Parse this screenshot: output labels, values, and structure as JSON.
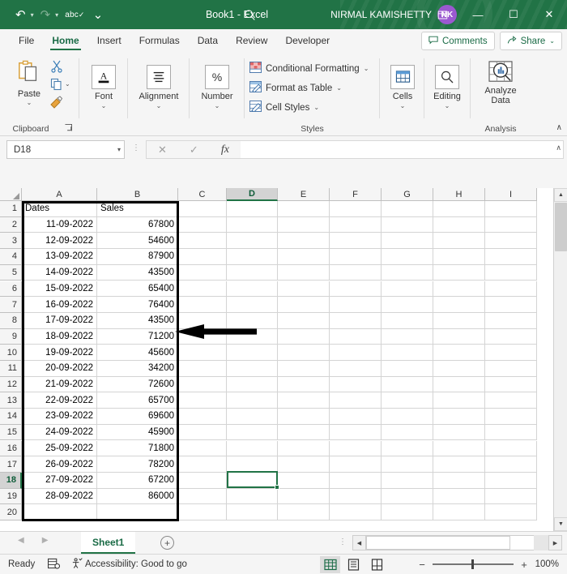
{
  "titlebar": {
    "document_title": "Book1  -  Excel",
    "account_name": "NIRMAL KAMISHETTY",
    "avatar_initials": "NK",
    "qat": [
      {
        "name": "undo",
        "glyph": "↶"
      },
      {
        "name": "redo",
        "glyph": "↷"
      },
      {
        "name": "spelling",
        "glyph": "abc"
      },
      {
        "name": "customize-qat",
        "glyph": "⌄"
      }
    ],
    "search_glyph": "⚲",
    "window_controls": {
      "ribbon_display": "⤒",
      "minimize": "—",
      "maximize": "☐",
      "close": "✕"
    }
  },
  "tabs": [
    {
      "label": "File",
      "active": false
    },
    {
      "label": "Home",
      "active": true
    },
    {
      "label": "Insert",
      "active": false
    },
    {
      "label": "Formulas",
      "active": false
    },
    {
      "label": "Data",
      "active": false
    },
    {
      "label": "Review",
      "active": false
    },
    {
      "label": "Developer",
      "active": false
    }
  ],
  "tabrow_right": {
    "comments_label": "Comments",
    "comments_icon": "▢",
    "share_label": "Share",
    "share_icon": "↗",
    "share_caret": "⌄"
  },
  "ribbon": {
    "clipboard": {
      "group_label": "Clipboard",
      "paste_label": "Paste",
      "paste_caret": "⌄",
      "cut_icon": "✂",
      "copy_icon": "❐",
      "copy_caret": "⌄",
      "format_painter_icon": "✎",
      "dialog_launcher": "↘"
    },
    "font": {
      "label": "Font",
      "icon": "A",
      "caret": "⌄"
    },
    "alignment": {
      "label": "Alignment",
      "icon": "≡",
      "caret": "⌄"
    },
    "number": {
      "label": "Number",
      "icon": "%",
      "caret": "⌄"
    },
    "styles": {
      "group_label": "Styles",
      "items": [
        {
          "label": "Conditional Formatting",
          "caret": "⌄"
        },
        {
          "label": "Format as Table",
          "caret": "⌄"
        },
        {
          "label": "Cell Styles",
          "caret": "⌄"
        }
      ]
    },
    "cells": {
      "label": "Cells",
      "icon": "⊞",
      "caret": "⌄"
    },
    "editing": {
      "label": "Editing",
      "icon": "⚲",
      "caret": "⌄"
    },
    "analysis": {
      "group_label": "Analysis",
      "analyze_label_line1": "Analyze",
      "analyze_label_line2": "Data"
    },
    "collapse_icon": "∧"
  },
  "formula_bar": {
    "name_box_value": "D18",
    "name_box_caret": "▾",
    "dots": "⋮",
    "cancel_icon": "✕",
    "enter_icon": "✓",
    "function_icon": "fx",
    "formula_value": "",
    "expand_icon": "∧"
  },
  "grid": {
    "column_headers": [
      "A",
      "B",
      "C",
      "D",
      "E",
      "F",
      "G",
      "H",
      "I"
    ],
    "selected_column": "D",
    "row_headers": [
      "1",
      "2",
      "3",
      "4",
      "5",
      "6",
      "7",
      "8",
      "9",
      "10",
      "11",
      "12",
      "13",
      "14",
      "15",
      "16",
      "17",
      "18",
      "19",
      "20"
    ],
    "selected_row": "18",
    "headers": [
      "Dates",
      "Sales"
    ],
    "rows": [
      {
        "date": "11-09-2022",
        "sales": "67800"
      },
      {
        "date": "12-09-2022",
        "sales": "54600"
      },
      {
        "date": "13-09-2022",
        "sales": "87900"
      },
      {
        "date": "14-09-2022",
        "sales": "43500"
      },
      {
        "date": "15-09-2022",
        "sales": "65400"
      },
      {
        "date": "16-09-2022",
        "sales": "76400"
      },
      {
        "date": "17-09-2022",
        "sales": "43500"
      },
      {
        "date": "18-09-2022",
        "sales": "71200"
      },
      {
        "date": "19-09-2022",
        "sales": "45600"
      },
      {
        "date": "20-09-2022",
        "sales": "34200"
      },
      {
        "date": "21-09-2022",
        "sales": "72600"
      },
      {
        "date": "22-09-2022",
        "sales": "65700"
      },
      {
        "date": "23-09-2022",
        "sales": "69600"
      },
      {
        "date": "24-09-2022",
        "sales": "45900"
      },
      {
        "date": "25-09-2022",
        "sales": "71800"
      },
      {
        "date": "26-09-2022",
        "sales": "78200"
      },
      {
        "date": "27-09-2022",
        "sales": "67200"
      },
      {
        "date": "28-09-2022",
        "sales": "86000"
      }
    ],
    "selected_cell": "D18",
    "bordered_range": "A1:B19",
    "annotation": {
      "name": "left-pointing-arrow",
      "points_to": "row-9-area"
    },
    "scroll_up_icon": "▲",
    "scroll_down_icon": "▼"
  },
  "sheetbar": {
    "prev_icon": "◀",
    "next_icon": "▶",
    "sheets": [
      {
        "label": "Sheet1",
        "active": true
      }
    ],
    "add_sheet_icon": "+",
    "dots": "⋮",
    "hscroll_left": "◀",
    "hscroll_right": "▶"
  },
  "statusbar": {
    "mode": "Ready",
    "macro_icon": "▤",
    "accessibility_icon": "⛹",
    "accessibility_text": "Accessibility: Good to go",
    "views": [
      {
        "name": "normal-view",
        "icon": "⊞",
        "active": true
      },
      {
        "name": "page-layout-view",
        "icon": "▤",
        "active": false
      },
      {
        "name": "page-break-view",
        "icon": "▥",
        "active": false
      }
    ],
    "zoom_out": "−",
    "zoom_in": "+",
    "zoom_level": "100%"
  },
  "colors": {
    "brand_green": "#217346",
    "avatar_purple": "#9b59d0",
    "selection_green": "#217346",
    "annotation_black": "#000000"
  }
}
